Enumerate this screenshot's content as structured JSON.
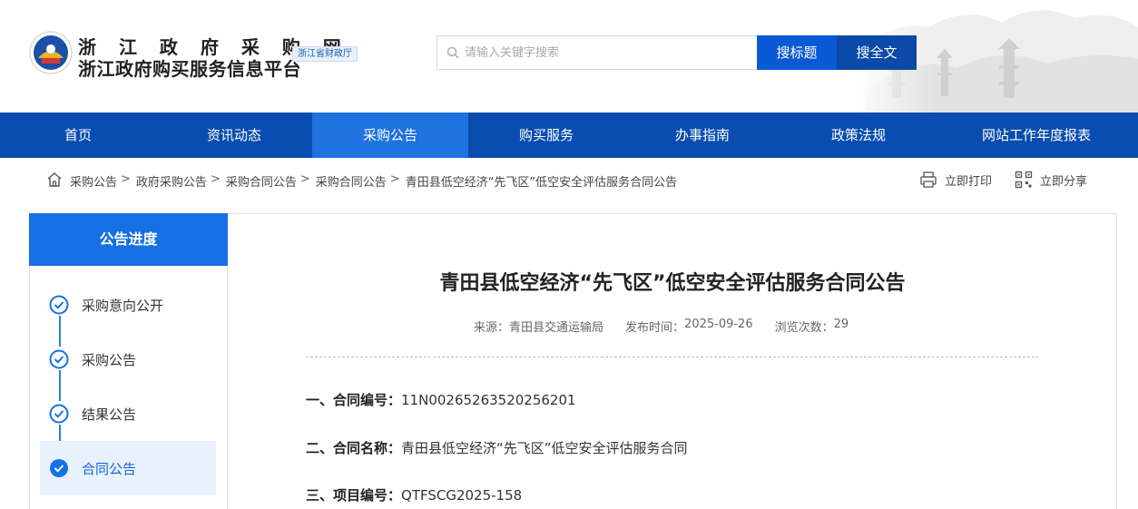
{
  "header": {
    "site_title_line1": "浙 江 政 府 采 购 网",
    "site_title_line2": "浙江政府购买服务信息平台",
    "dept_badge": "浙江省财政厅",
    "logo_icon": "emblem-icon"
  },
  "search": {
    "placeholder": "请输入关键字搜索",
    "btn_title": "搜标题",
    "btn_fulltext": "搜全文"
  },
  "nav": {
    "items": [
      "首页",
      "资讯动态",
      "采购公告",
      "购买服务",
      "办事指南",
      "政策法规",
      "网站工作年度报表"
    ],
    "active_index": 2
  },
  "breadcrumb": {
    "items": [
      "采购公告",
      "政府采购公告",
      "采购合同公告",
      "采购合同公告",
      "青田县低空经济“先飞区”低空安全评估服务合同公告"
    ],
    "separator": ">"
  },
  "tools": {
    "print_label": "立即打印",
    "share_label": "立即分享"
  },
  "sidebar": {
    "title": "公告进度",
    "steps": [
      {
        "label": "采购意向公开",
        "done": true
      },
      {
        "label": "采购公告",
        "done": true
      },
      {
        "label": "结果公告",
        "done": true
      },
      {
        "label": "合同公告",
        "done": true,
        "active": true
      }
    ]
  },
  "article": {
    "title": "青田县低空经济“先飞区”低空安全评估服务合同公告",
    "source_label": "来源：",
    "source": "青田县交通运输局",
    "publish_label": "发布时间：",
    "publish_date": "2025-09-26",
    "views_label": "浏览次数：",
    "views": "29",
    "sections": [
      {
        "key": "一、合同编号：",
        "value": "11N00265263520256201"
      },
      {
        "key": "二、合同名称：",
        "value": "青田县低空经济“先飞区”低空安全评估服务合同"
      },
      {
        "key": "三、项目编号：",
        "value": "QTFSCG2025-158"
      }
    ]
  },
  "colors": {
    "nav_bg": "#0a4db0",
    "nav_active": "#1f72e0",
    "accent": "#1670e4",
    "btn_title_bg": "#0a5ad6",
    "btn_full_bg": "#0b4aa8"
  }
}
